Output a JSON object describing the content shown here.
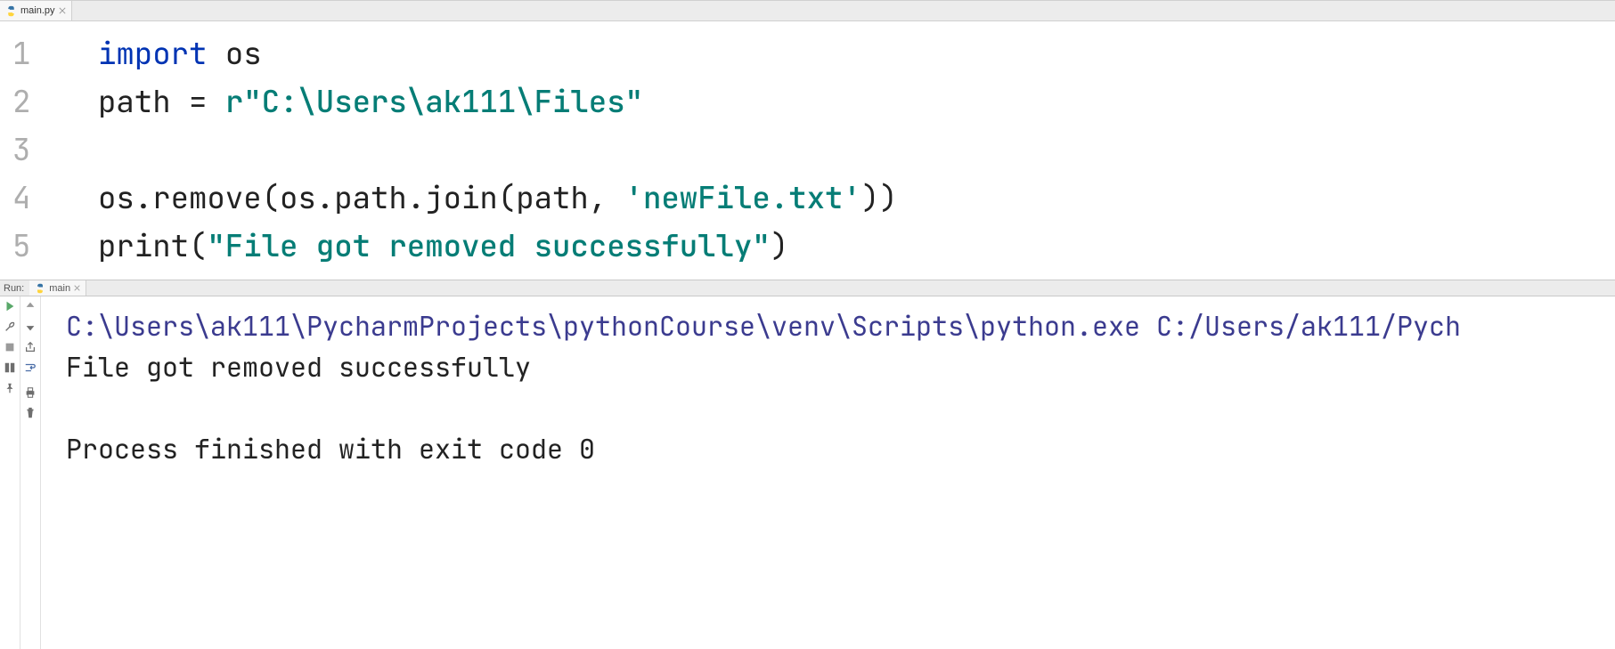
{
  "tab": {
    "filename": "main.py"
  },
  "code": {
    "lines": [
      {
        "n": "1",
        "segments": [
          {
            "t": "import ",
            "c": "kw"
          },
          {
            "t": "os",
            "c": "id"
          }
        ]
      },
      {
        "n": "2",
        "segments": [
          {
            "t": "path = ",
            "c": "id"
          },
          {
            "t": "r\"C:\\Users\\ak111\\Files\"",
            "c": "str"
          }
        ]
      },
      {
        "n": "3",
        "segments": [
          {
            "t": "",
            "c": "id"
          }
        ]
      },
      {
        "n": "4",
        "segments": [
          {
            "t": "os.remove(os.path.join(path, ",
            "c": "fn"
          },
          {
            "t": "'newFile.txt'",
            "c": "str"
          },
          {
            "t": "))",
            "c": "fn"
          }
        ]
      },
      {
        "n": "5",
        "segments": [
          {
            "t": "print(",
            "c": "fn"
          },
          {
            "t": "\"File got removed successfully\"",
            "c": "str"
          },
          {
            "t": ")",
            "c": "fn"
          }
        ]
      }
    ]
  },
  "run": {
    "label": "Run:",
    "config": "main",
    "output": [
      {
        "text": "C:\\Users\\ak111\\PycharmProjects\\pythonCourse\\venv\\Scripts\\python.exe C:/Users/ak111/Pych",
        "cls": "cmd"
      },
      {
        "text": "File got removed successfully",
        "cls": ""
      },
      {
        "text": "",
        "cls": ""
      },
      {
        "text": "Process finished with exit code 0",
        "cls": ""
      }
    ]
  },
  "icons": {
    "play": "play-icon",
    "wrench": "wrench-icon",
    "stop": "stop-icon",
    "layout": "layout-icon",
    "pin": "pin-icon",
    "up": "arrow-up-icon",
    "down": "arrow-down-icon",
    "export": "export-icon",
    "wrap": "soft-wrap-icon",
    "print": "print-icon",
    "trash": "trash-icon"
  }
}
